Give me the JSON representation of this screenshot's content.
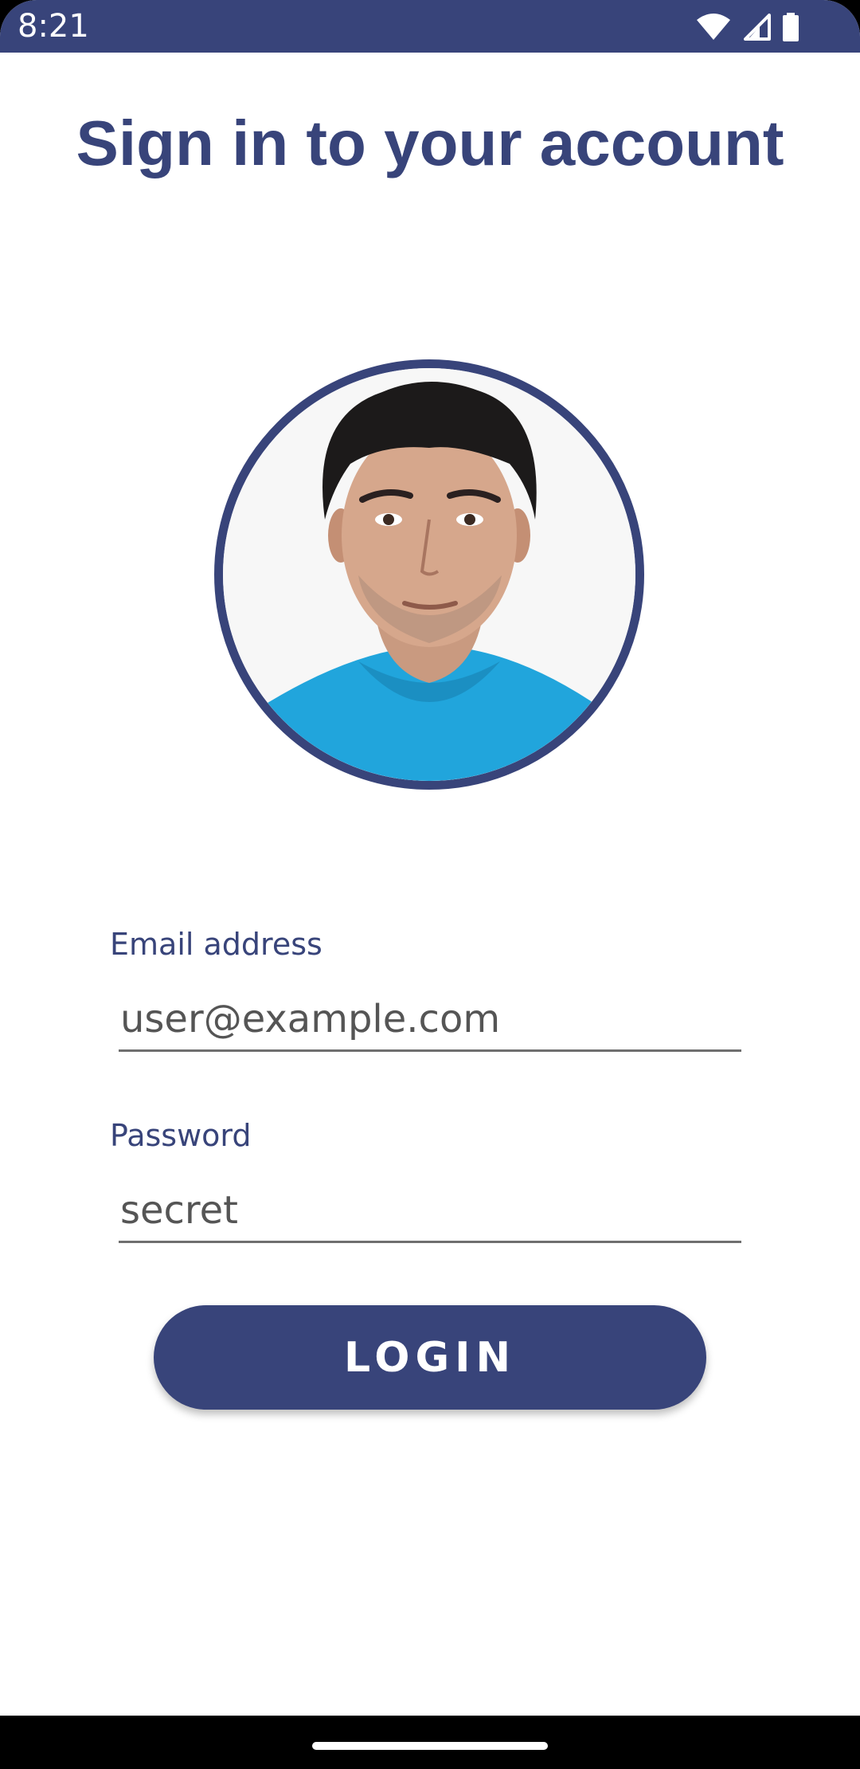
{
  "status_bar": {
    "time": "8:21",
    "icons": [
      "wifi-icon",
      "cell-signal-icon",
      "battery-icon"
    ],
    "background": "#38447a"
  },
  "page": {
    "title": "Sign in to your account"
  },
  "avatar": {
    "description_icon": "profile-photo",
    "border_color": "#38447a"
  },
  "form": {
    "email_label": "Email address",
    "email_value": "user@example.com",
    "password_label": "Password",
    "password_value": "secret",
    "login_label": "LOGIN"
  },
  "colors": {
    "accent": "#38447a",
    "text_secondary": "#555555"
  }
}
